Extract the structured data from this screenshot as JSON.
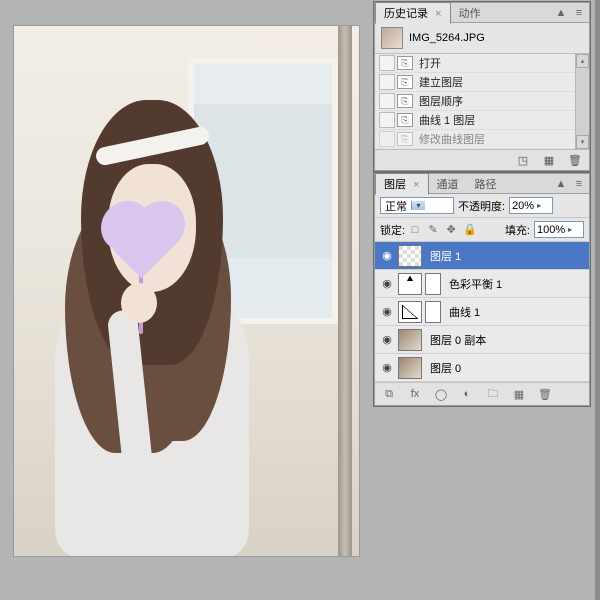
{
  "history": {
    "tabs": [
      {
        "label": "历史记录",
        "active": true,
        "closeable_glyph": "×"
      },
      {
        "label": "动作",
        "active": false
      }
    ],
    "filename": "IMG_5264.JPG",
    "items": [
      {
        "label": "打开"
      },
      {
        "label": "建立图层"
      },
      {
        "label": "图层顺序"
      },
      {
        "label": "曲线 1 图层"
      },
      {
        "label": "修改曲线图层"
      }
    ]
  },
  "layers": {
    "tabs": [
      {
        "label": "图层",
        "active": true,
        "closeable_glyph": "×"
      },
      {
        "label": "通道",
        "active": false
      },
      {
        "label": "路径",
        "active": false
      }
    ],
    "blendmode": "正常",
    "opacity_label": "不透明度:",
    "opacity_value": "20%",
    "lock_label": "锁定:",
    "fill_label": "填充:",
    "fill_value": "100%",
    "items": [
      {
        "name": "图层 1",
        "selected": true,
        "thumb": "checker"
      },
      {
        "name": "色彩平衡 1",
        "selected": false,
        "thumb": "cbal",
        "mask": true
      },
      {
        "name": "曲线 1",
        "selected": false,
        "thumb": "curves",
        "mask": true
      },
      {
        "name": "图层 0 副本",
        "selected": false,
        "thumb": "mini"
      },
      {
        "name": "图层 0",
        "selected": false,
        "thumb": "mini"
      }
    ]
  },
  "glyph": {
    "eye": "◉",
    "link": "⧉",
    "fx": "fx",
    "newmask": "◯",
    "adj": "◐",
    "folder": "🗀",
    "newlayer": "▦",
    "trash": "🗑",
    "camera": "◳",
    "menu": "≡",
    "minimize": "▲",
    "tri_up": "▴",
    "tri_down": "▾",
    "arrow_r": "▸",
    "doc": "⎘",
    "hand": "✥",
    "lockbox": "□",
    "brush": "✎",
    "lockpos": "✥",
    "lockall": "🔒"
  }
}
